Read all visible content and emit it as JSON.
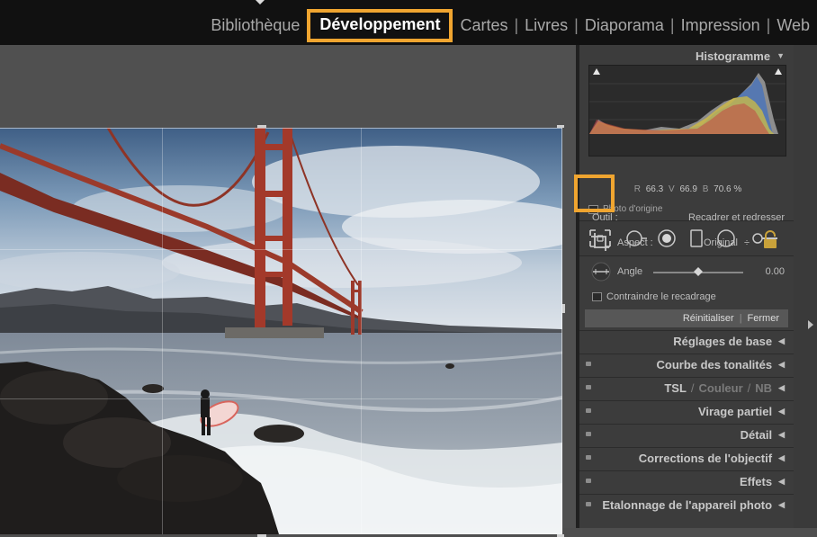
{
  "module_bar": {
    "modules": [
      {
        "label": "Bibliothèque",
        "active": false
      },
      {
        "label": "Développement",
        "active": true
      },
      {
        "label": "Cartes",
        "active": false
      },
      {
        "label": "Livres",
        "active": false
      },
      {
        "label": "Diaporama",
        "active": false
      },
      {
        "label": "Impression",
        "active": false
      },
      {
        "label": "Web",
        "active": false
      }
    ],
    "separator": "|",
    "highlight_color": "#f0a530"
  },
  "histogram": {
    "title": "Histogramme",
    "collapse_glyph": "▼",
    "readout": {
      "r_label": "R",
      "r_value": "66.3",
      "v_label": "V",
      "v_value": "66.9",
      "b_label": "B",
      "b_value": "70.6 %"
    },
    "original_photo_label": "Photo d'origine"
  },
  "toolstrip": {
    "tools": [
      "crop-overlay-icon",
      "spot-removal-icon",
      "red-eye-icon",
      "graduated-filter-icon",
      "radial-filter-icon",
      "adjustment-brush-icon"
    ]
  },
  "crop_panel": {
    "tool_label": "Outil :",
    "tool_value": "Recadrer et redresser",
    "aspect_label": "Aspect :",
    "aspect_value": "Original",
    "aspect_spinner": "÷",
    "angle_label": "Angle",
    "angle_value": "0.00",
    "constrain_label": "Contraindre le recadrage",
    "reset_label": "Réinitialiser",
    "close_label": "Fermer",
    "sep": "|"
  },
  "panels": {
    "basic": "Réglages de base",
    "tone_curve": "Courbe des tonalités",
    "tsl": "TSL",
    "couleur": "Couleur",
    "nb": "NB",
    "slash": "/",
    "split_toning": "Virage partiel",
    "detail": "Détail",
    "lens": "Corrections de l'objectif",
    "effects": "Effets",
    "calibration": "Etalonnage de l'appareil photo",
    "expand_glyph": "◀"
  }
}
